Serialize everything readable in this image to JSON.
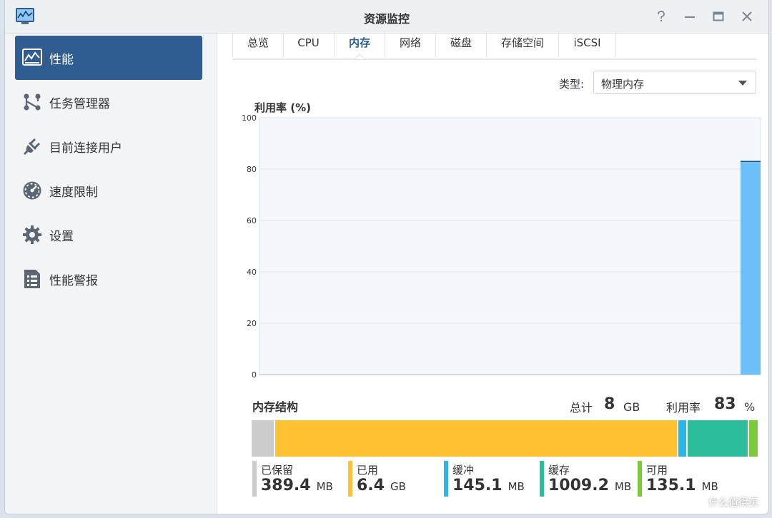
{
  "window": {
    "title": "资源监控",
    "controls": [
      "help-icon",
      "minimize-icon",
      "maximize-icon",
      "close-icon"
    ]
  },
  "sidebar": {
    "items": [
      {
        "label": "性能",
        "icon": "performance-chart-icon",
        "active": true
      },
      {
        "label": "任务管理器",
        "icon": "task-manager-icon",
        "active": false
      },
      {
        "label": "目前连接用户",
        "icon": "plug-icon",
        "active": false
      },
      {
        "label": "速度限制",
        "icon": "speedometer-icon",
        "active": false
      },
      {
        "label": "设置",
        "icon": "gear-icon",
        "active": false
      },
      {
        "label": "性能警报",
        "icon": "alert-list-icon",
        "active": false
      }
    ]
  },
  "tabs": [
    {
      "label": "总览",
      "active": false
    },
    {
      "label": "CPU",
      "active": false
    },
    {
      "label": "内存",
      "active": true
    },
    {
      "label": "网络",
      "active": false
    },
    {
      "label": "磁盘",
      "active": false
    },
    {
      "label": "存储空间",
      "active": false
    },
    {
      "label": "iSCSI",
      "active": false
    }
  ],
  "type_selector": {
    "label": "类型:",
    "value": "物理内存"
  },
  "chart_data": {
    "type": "area",
    "title": "",
    "ylabel": "利用率 (%)",
    "xlabel": "",
    "ylim": [
      0,
      100
    ],
    "yticks": [
      0,
      20,
      40,
      60,
      80,
      100
    ],
    "grid": true,
    "series": [
      {
        "values": [
          83
        ],
        "color": "#6ec0f9"
      }
    ]
  },
  "memory": {
    "title": "内存结构",
    "total_label": "总计",
    "total_value": "8",
    "total_unit": "GB",
    "usage_label": "利用率",
    "usage_value": "83",
    "usage_unit": "%",
    "segments": [
      {
        "name": "已保留",
        "value": "389.4",
        "unit": "MB",
        "mb": 389.4,
        "color": "#cccccc"
      },
      {
        "name": "已用",
        "value": "6.4",
        "unit": "GB",
        "mb": 6553.6,
        "color": "#ffc233"
      },
      {
        "name": "缓冲",
        "value": "145.1",
        "unit": "MB",
        "mb": 145.1,
        "color": "#2cb6e8"
      },
      {
        "name": "缓存",
        "value": "1009.2",
        "unit": "MB",
        "mb": 1009.2,
        "color": "#2bbd9c"
      },
      {
        "name": "可用",
        "value": "135.1",
        "unit": "MB",
        "mb": 135.1,
        "color": "#7cc93c"
      }
    ]
  },
  "watermark": {
    "text": "什么值得买"
  }
}
